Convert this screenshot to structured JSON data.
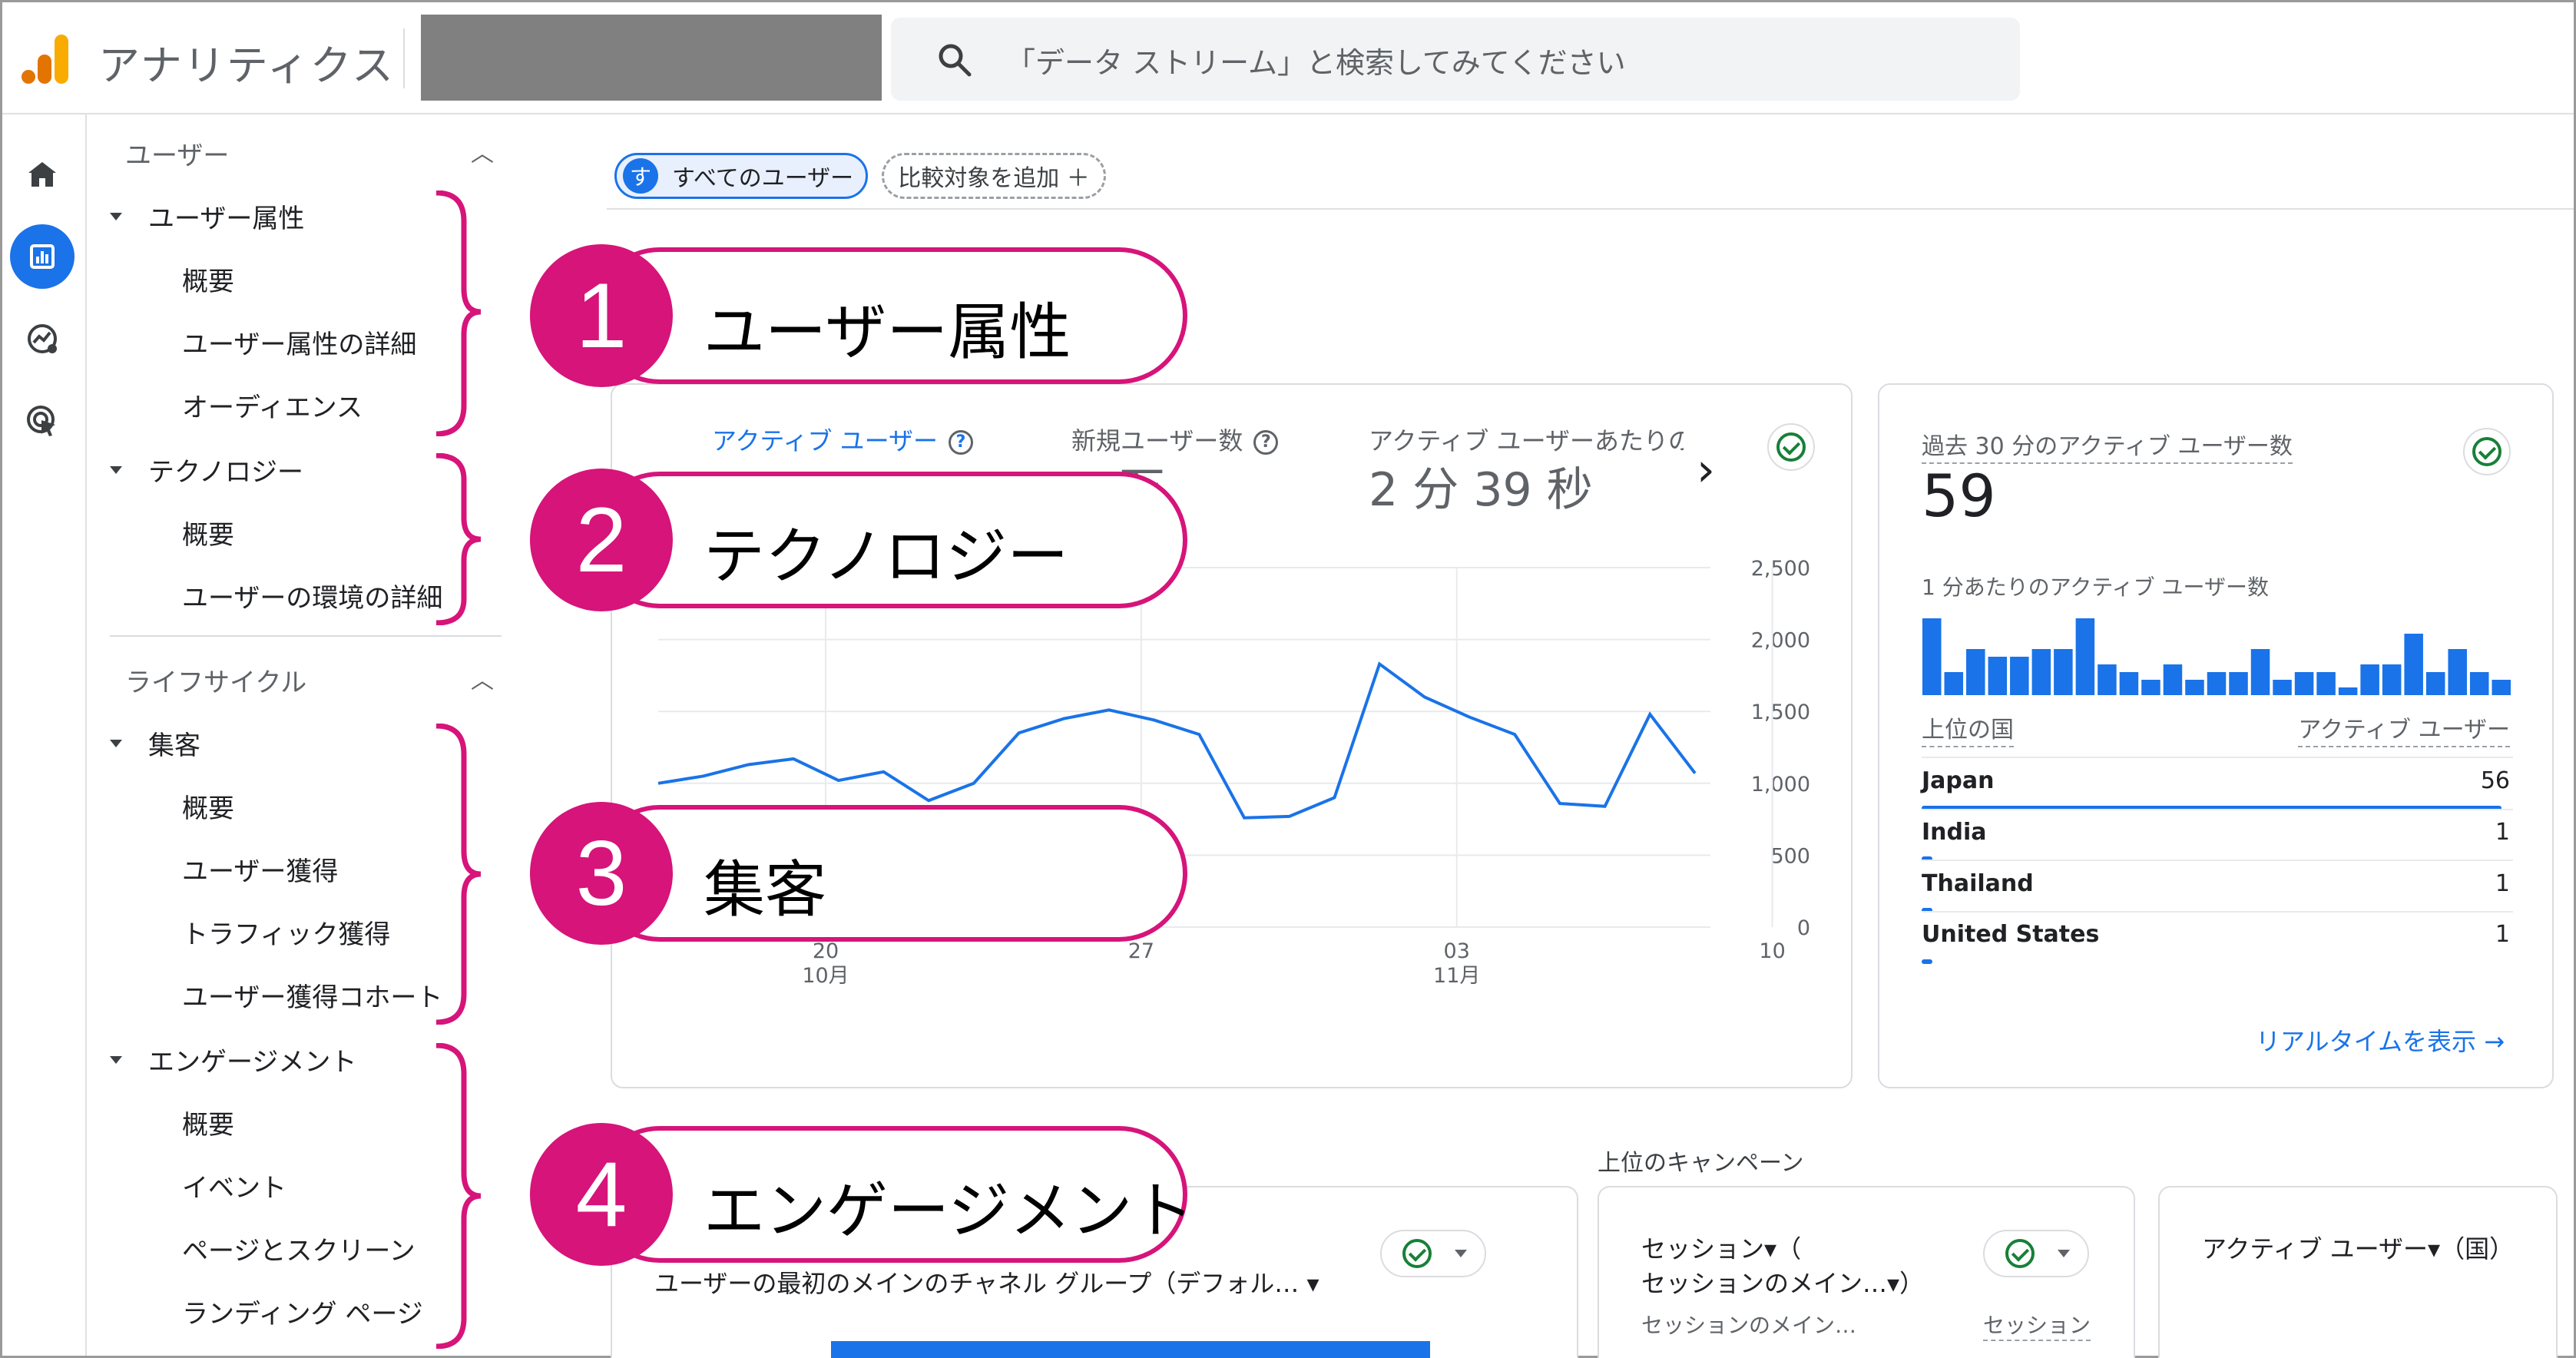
{
  "header": {
    "app_title": "アナリティクス",
    "search_placeholder": "「データ ストリーム」と検索してみてください"
  },
  "nav": {
    "users_section": "ユーザー",
    "demographics_group": "ユーザー属性",
    "demographics_items": [
      "概要",
      "ユーザー属性の詳細",
      "オーディエンス"
    ],
    "tech_group": "テクノロジー",
    "tech_items": [
      "概要",
      "ユーザーの環境の詳細"
    ],
    "lifecycle_section": "ライフサイクル",
    "acq_group": "集客",
    "acq_items": [
      "概要",
      "ユーザー獲得",
      "トラフィック獲得",
      "ユーザー獲得コホート"
    ],
    "eng_group": "エンゲージメント",
    "eng_items": [
      "概要",
      "イベント",
      "ページとスクリーン",
      "ランディング ページ"
    ]
  },
  "filters": {
    "all_users_avatar": "す",
    "all_users": "すべてのユーザー",
    "add_comparison": "比較対象を追加 ＋"
  },
  "main_card": {
    "tab_active_users": "アクティブ ユーザー",
    "tab_new_users": "新規ユーザー数",
    "tab_avg_engagement": "アクティブ ユーザーあたりの",
    "new_users_value_partial": "万",
    "avg_engagement_value": "2 分 39 秒"
  },
  "chart_data": {
    "type": "line",
    "x": [
      20,
      21,
      22,
      23,
      24,
      25,
      26,
      27,
      28,
      29,
      30,
      31,
      1,
      2,
      3,
      4,
      5,
      6,
      7,
      8,
      9,
      10,
      11,
      12
    ],
    "values": [
      1000,
      1050,
      1130,
      1170,
      1020,
      1080,
      880,
      1000,
      1350,
      1450,
      1510,
      1440,
      1340,
      760,
      770,
      900,
      1830,
      1600,
      1460,
      1340,
      860,
      840,
      1480,
      1070
    ],
    "ylim": [
      0,
      2500
    ],
    "y_ticks": [
      "2,500",
      "2,000",
      "1,500",
      "1,000",
      "500",
      "0"
    ],
    "x_ticks": [
      {
        "day": "20",
        "month": "10月"
      },
      {
        "day": "27",
        "month": ""
      },
      {
        "day": "03",
        "month": "11月"
      },
      {
        "day": "10",
        "month": ""
      }
    ]
  },
  "realtime": {
    "title": "過去 30 分のアクティブ ユーザー数",
    "count": "59",
    "per_minute_label": "1 分あたりのアクティブ ユーザー数",
    "per_minute_values": [
      10,
      3,
      6,
      5,
      5,
      6,
      6,
      10,
      4,
      3,
      2,
      4,
      2,
      3,
      3,
      6,
      2,
      3,
      3,
      1,
      4,
      4,
      8,
      3,
      6,
      3,
      2
    ],
    "col_country": "上位の国",
    "col_users": "アクティブ ユーザー",
    "rows": [
      {
        "country": "Japan",
        "users": "56",
        "share": 0.98
      },
      {
        "country": "India",
        "users": "1",
        "share": 0.018
      },
      {
        "country": "Thailand",
        "users": "1",
        "share": 0.018
      },
      {
        "country": "United States",
        "users": "1",
        "share": 0.018
      }
    ],
    "link": "リアルタイムを表示 →"
  },
  "bottom": {
    "channel_dropdown": "ユーザーの最初のメインのチャネル グループ（デフォル…  ▾",
    "campaigns_title": "上位のキャンペーン",
    "sessions_line1": "セッション▾（",
    "sessions_line2": "セッションのメイン…▾）",
    "sessions_col1": "セッションのメイン…",
    "sessions_col2": "セッション",
    "country_dropdown": "アクティブ ユーザー▾（国）"
  },
  "callouts": [
    {
      "num": "1",
      "text": "ユーザー属性"
    },
    {
      "num": "2",
      "text": "テクノロジー"
    },
    {
      "num": "3",
      "text": "集客"
    },
    {
      "num": "4",
      "text": "エンゲージメント"
    }
  ],
  "colors": {
    "accent": "#1a73e8",
    "callout": "#d6147a",
    "success": "#188038"
  }
}
